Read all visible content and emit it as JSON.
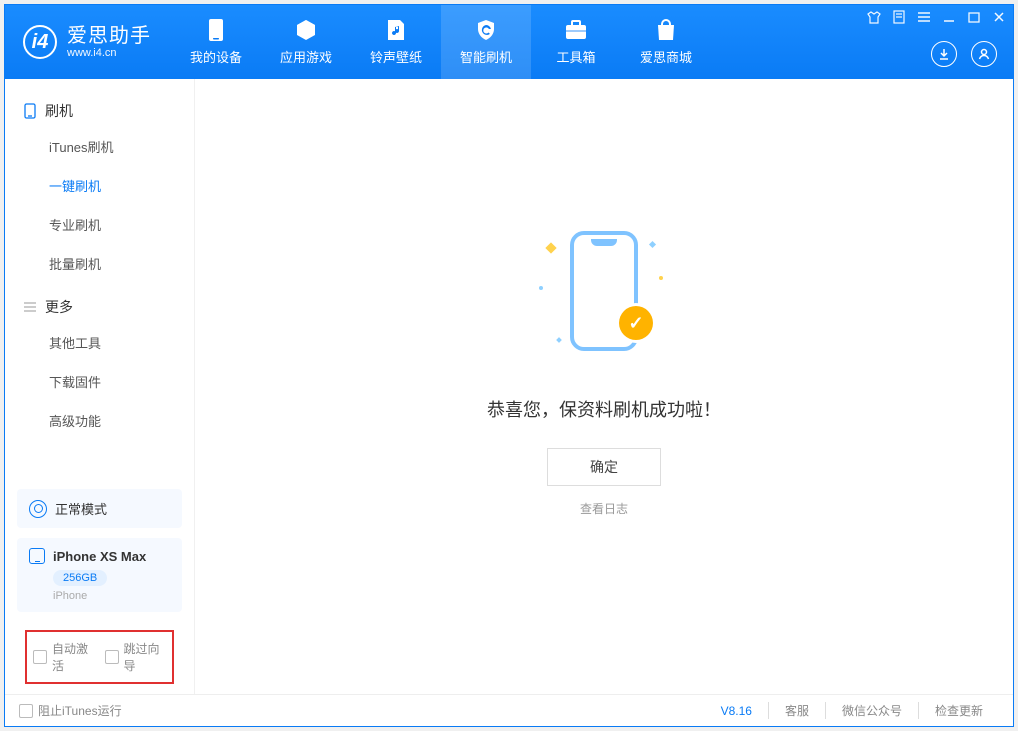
{
  "brand": {
    "name": "爱思助手",
    "url": "www.i4.cn"
  },
  "nav": {
    "items": [
      {
        "label": "我的设备"
      },
      {
        "label": "应用游戏"
      },
      {
        "label": "铃声壁纸"
      },
      {
        "label": "智能刷机"
      },
      {
        "label": "工具箱"
      },
      {
        "label": "爱思商城"
      }
    ]
  },
  "sidebar": {
    "group1": {
      "title": "刷机"
    },
    "items1": [
      {
        "label": "iTunes刷机"
      },
      {
        "label": "一键刷机"
      },
      {
        "label": "专业刷机"
      },
      {
        "label": "批量刷机"
      }
    ],
    "group2": {
      "title": "更多"
    },
    "items2": [
      {
        "label": "其他工具"
      },
      {
        "label": "下载固件"
      },
      {
        "label": "高级功能"
      }
    ],
    "mode": "正常模式",
    "device": {
      "name": "iPhone XS Max",
      "storage": "256GB",
      "type": "iPhone"
    },
    "opts": {
      "auto_activate": "自动激活",
      "skip_guide": "跳过向导"
    }
  },
  "main": {
    "title": "恭喜您，保资料刷机成功啦！",
    "ok": "确定",
    "log": "查看日志"
  },
  "status": {
    "block_itunes": "阻止iTunes运行",
    "version": "V8.16",
    "links": [
      "客服",
      "微信公众号",
      "检查更新"
    ]
  }
}
